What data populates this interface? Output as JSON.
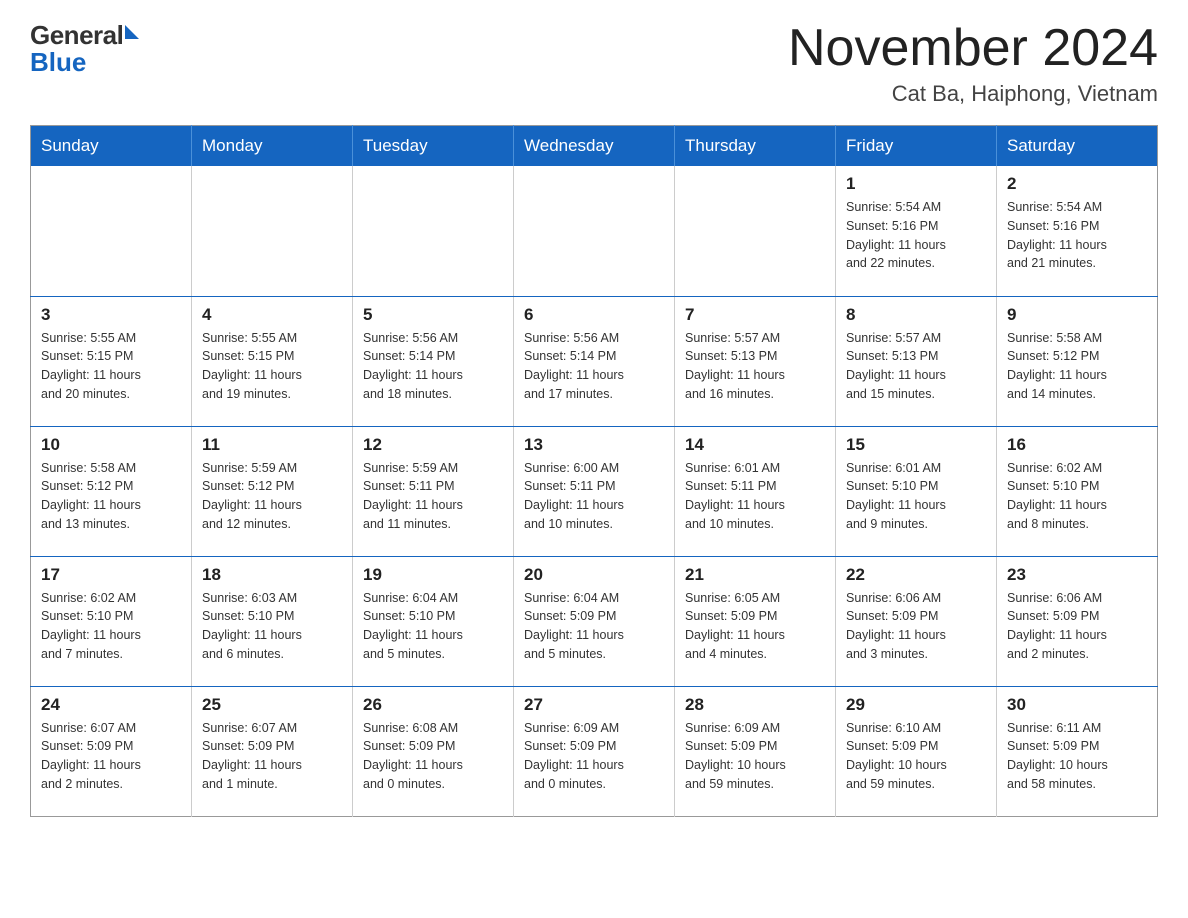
{
  "header": {
    "logo": {
      "text_general": "General",
      "text_blue": "Blue"
    },
    "title": "November 2024",
    "subtitle": "Cat Ba, Haiphong, Vietnam"
  },
  "weekdays": [
    "Sunday",
    "Monday",
    "Tuesday",
    "Wednesday",
    "Thursday",
    "Friday",
    "Saturday"
  ],
  "weeks": [
    [
      {
        "day": "",
        "info": ""
      },
      {
        "day": "",
        "info": ""
      },
      {
        "day": "",
        "info": ""
      },
      {
        "day": "",
        "info": ""
      },
      {
        "day": "",
        "info": ""
      },
      {
        "day": "1",
        "info": "Sunrise: 5:54 AM\nSunset: 5:16 PM\nDaylight: 11 hours\nand 22 minutes."
      },
      {
        "day": "2",
        "info": "Sunrise: 5:54 AM\nSunset: 5:16 PM\nDaylight: 11 hours\nand 21 minutes."
      }
    ],
    [
      {
        "day": "3",
        "info": "Sunrise: 5:55 AM\nSunset: 5:15 PM\nDaylight: 11 hours\nand 20 minutes."
      },
      {
        "day": "4",
        "info": "Sunrise: 5:55 AM\nSunset: 5:15 PM\nDaylight: 11 hours\nand 19 minutes."
      },
      {
        "day": "5",
        "info": "Sunrise: 5:56 AM\nSunset: 5:14 PM\nDaylight: 11 hours\nand 18 minutes."
      },
      {
        "day": "6",
        "info": "Sunrise: 5:56 AM\nSunset: 5:14 PM\nDaylight: 11 hours\nand 17 minutes."
      },
      {
        "day": "7",
        "info": "Sunrise: 5:57 AM\nSunset: 5:13 PM\nDaylight: 11 hours\nand 16 minutes."
      },
      {
        "day": "8",
        "info": "Sunrise: 5:57 AM\nSunset: 5:13 PM\nDaylight: 11 hours\nand 15 minutes."
      },
      {
        "day": "9",
        "info": "Sunrise: 5:58 AM\nSunset: 5:12 PM\nDaylight: 11 hours\nand 14 minutes."
      }
    ],
    [
      {
        "day": "10",
        "info": "Sunrise: 5:58 AM\nSunset: 5:12 PM\nDaylight: 11 hours\nand 13 minutes."
      },
      {
        "day": "11",
        "info": "Sunrise: 5:59 AM\nSunset: 5:12 PM\nDaylight: 11 hours\nand 12 minutes."
      },
      {
        "day": "12",
        "info": "Sunrise: 5:59 AM\nSunset: 5:11 PM\nDaylight: 11 hours\nand 11 minutes."
      },
      {
        "day": "13",
        "info": "Sunrise: 6:00 AM\nSunset: 5:11 PM\nDaylight: 11 hours\nand 10 minutes."
      },
      {
        "day": "14",
        "info": "Sunrise: 6:01 AM\nSunset: 5:11 PM\nDaylight: 11 hours\nand 10 minutes."
      },
      {
        "day": "15",
        "info": "Sunrise: 6:01 AM\nSunset: 5:10 PM\nDaylight: 11 hours\nand 9 minutes."
      },
      {
        "day": "16",
        "info": "Sunrise: 6:02 AM\nSunset: 5:10 PM\nDaylight: 11 hours\nand 8 minutes."
      }
    ],
    [
      {
        "day": "17",
        "info": "Sunrise: 6:02 AM\nSunset: 5:10 PM\nDaylight: 11 hours\nand 7 minutes."
      },
      {
        "day": "18",
        "info": "Sunrise: 6:03 AM\nSunset: 5:10 PM\nDaylight: 11 hours\nand 6 minutes."
      },
      {
        "day": "19",
        "info": "Sunrise: 6:04 AM\nSunset: 5:10 PM\nDaylight: 11 hours\nand 5 minutes."
      },
      {
        "day": "20",
        "info": "Sunrise: 6:04 AM\nSunset: 5:09 PM\nDaylight: 11 hours\nand 5 minutes."
      },
      {
        "day": "21",
        "info": "Sunrise: 6:05 AM\nSunset: 5:09 PM\nDaylight: 11 hours\nand 4 minutes."
      },
      {
        "day": "22",
        "info": "Sunrise: 6:06 AM\nSunset: 5:09 PM\nDaylight: 11 hours\nand 3 minutes."
      },
      {
        "day": "23",
        "info": "Sunrise: 6:06 AM\nSunset: 5:09 PM\nDaylight: 11 hours\nand 2 minutes."
      }
    ],
    [
      {
        "day": "24",
        "info": "Sunrise: 6:07 AM\nSunset: 5:09 PM\nDaylight: 11 hours\nand 2 minutes."
      },
      {
        "day": "25",
        "info": "Sunrise: 6:07 AM\nSunset: 5:09 PM\nDaylight: 11 hours\nand 1 minute."
      },
      {
        "day": "26",
        "info": "Sunrise: 6:08 AM\nSunset: 5:09 PM\nDaylight: 11 hours\nand 0 minutes."
      },
      {
        "day": "27",
        "info": "Sunrise: 6:09 AM\nSunset: 5:09 PM\nDaylight: 11 hours\nand 0 minutes."
      },
      {
        "day": "28",
        "info": "Sunrise: 6:09 AM\nSunset: 5:09 PM\nDaylight: 10 hours\nand 59 minutes."
      },
      {
        "day": "29",
        "info": "Sunrise: 6:10 AM\nSunset: 5:09 PM\nDaylight: 10 hours\nand 59 minutes."
      },
      {
        "day": "30",
        "info": "Sunrise: 6:11 AM\nSunset: 5:09 PM\nDaylight: 10 hours\nand 58 minutes."
      }
    ]
  ]
}
